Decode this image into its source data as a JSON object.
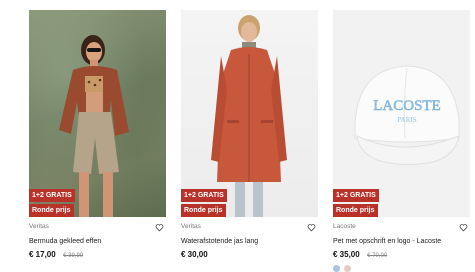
{
  "products": [
    {
      "brand": "Veritas",
      "name": "Bermuda gekleed effen",
      "price": "€ 17,00",
      "old_price": "€ 39,99",
      "tags": [
        "1+2 GRATIS",
        "Ronde prijs"
      ]
    },
    {
      "brand": "Veritas",
      "name": "Waterafstotende jas lang",
      "price": "€ 30,00",
      "old_price": "",
      "tags": [
        "1+2 GRATIS",
        "Ronde prijs"
      ]
    },
    {
      "brand": "Lacoste",
      "name": "Pet met opschrift en logo - Lacoste",
      "price": "€ 35,00",
      "old_price": "€ 70,00",
      "tags": [
        "1+2 GRATIS",
        "Ronde prijs"
      ],
      "cap_text": "LACOSTE",
      "cap_subtext": "PARIS",
      "swatches": [
        "#a9c4e3",
        "#e6c9bf"
      ]
    }
  ],
  "colors": {
    "tag_red": "#b8322a",
    "cap_blue": "#8fc3e8"
  },
  "icons": [
    "heart-icon"
  ]
}
